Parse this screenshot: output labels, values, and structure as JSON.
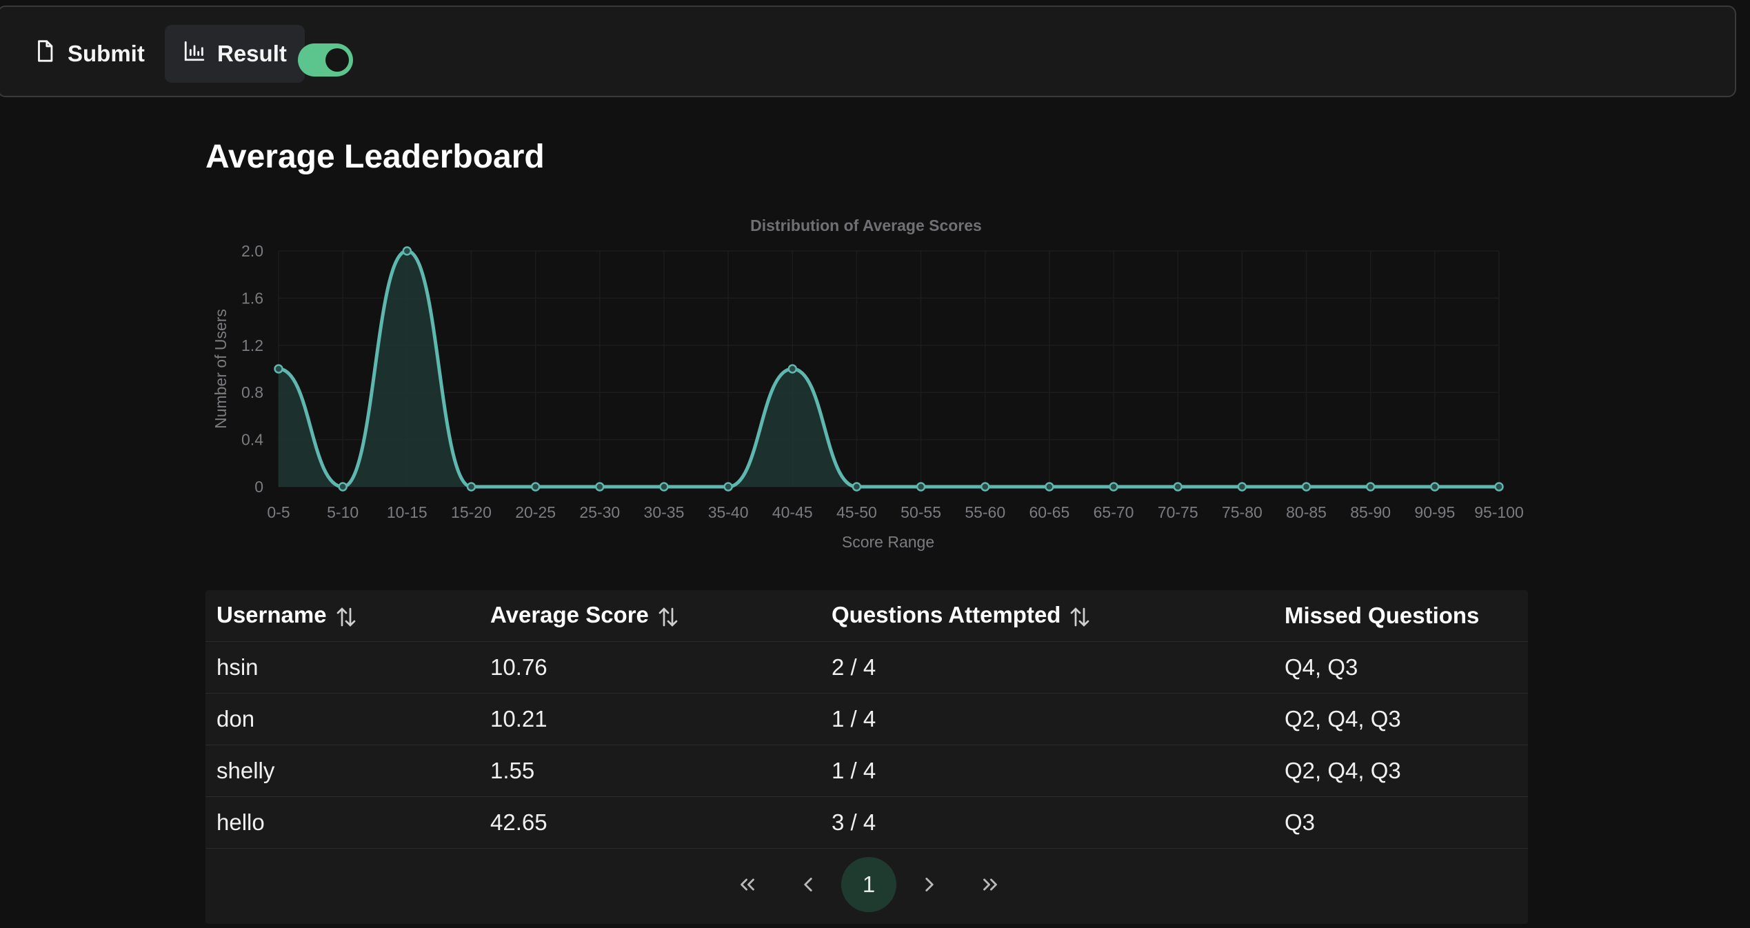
{
  "nav": {
    "submit_label": "Submit",
    "submit_icon": "file-icon",
    "result_label": "Result",
    "result_icon": "bar-chart-icon",
    "toggle_on": true
  },
  "page": {
    "title": "Average Leaderboard"
  },
  "colors": {
    "accent": "#5bc58d",
    "line": "#5fb8b0",
    "fill": "#1f3633",
    "background": "#111112"
  },
  "chart_data": {
    "type": "area",
    "title": "Distribution of Average Scores",
    "xlabel": "Score Range",
    "ylabel": "Number of Users",
    "categories": [
      "0-5",
      "5-10",
      "10-15",
      "15-20",
      "20-25",
      "25-30",
      "30-35",
      "35-40",
      "40-45",
      "45-50",
      "50-55",
      "55-60",
      "60-65",
      "65-70",
      "70-75",
      "75-80",
      "80-85",
      "85-90",
      "90-95",
      "95-100"
    ],
    "values": [
      1,
      0,
      2,
      0,
      0,
      0,
      0,
      0,
      1,
      0,
      0,
      0,
      0,
      0,
      0,
      0,
      0,
      0,
      0,
      0
    ],
    "ylim": [
      0,
      2
    ],
    "yticks": [
      "0",
      "0.4",
      "0.8",
      "1.2",
      "1.6",
      "2.0"
    ],
    "grid": true,
    "smooth": true
  },
  "table": {
    "headers": [
      "Username",
      "Average Score",
      "Questions Attempted",
      "Missed Questions"
    ],
    "rows": [
      [
        "hsin",
        "10.76",
        "2 / 4",
        "Q4, Q3"
      ],
      [
        "don",
        "10.21",
        "1 / 4",
        "Q2, Q4, Q3"
      ],
      [
        "shelly",
        "1.55",
        "1 / 4",
        "Q2, Q4, Q3"
      ],
      [
        "hello",
        "42.65",
        "3 / 4",
        "Q3"
      ]
    ]
  },
  "pagination": {
    "current_page": "1"
  }
}
